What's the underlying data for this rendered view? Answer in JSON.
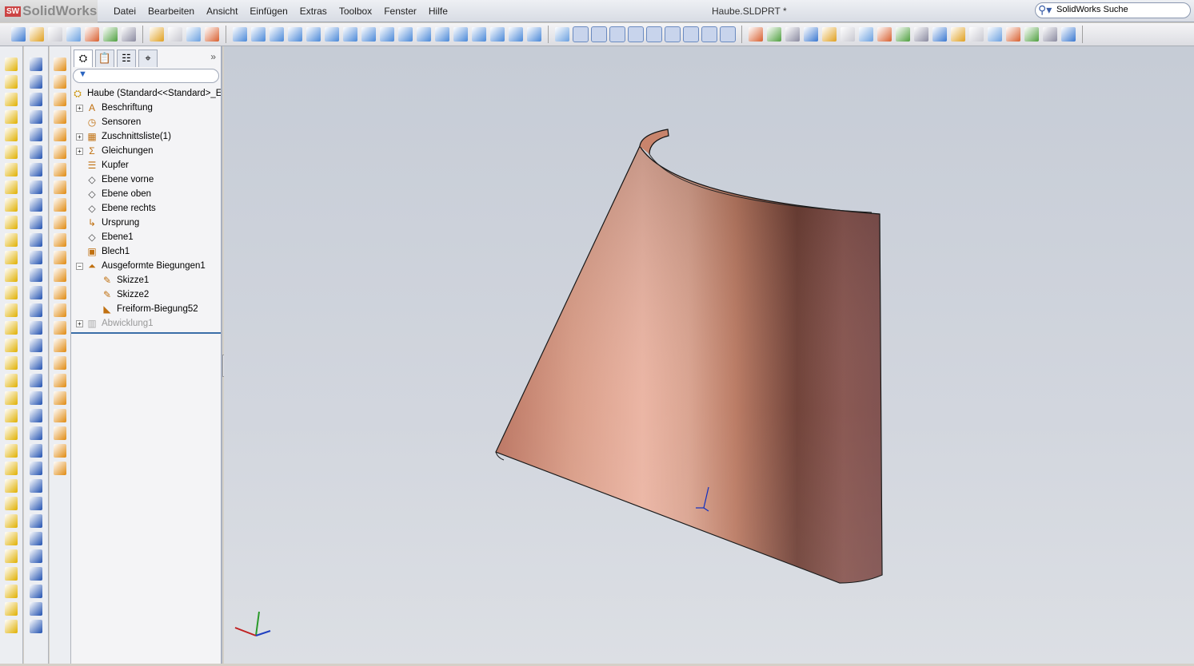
{
  "app": {
    "logo": "SolidWorks",
    "doc_title": "Haube.SLDPRT *"
  },
  "menu": [
    "Datei",
    "Bearbeiten",
    "Ansicht",
    "Einfügen",
    "Extras",
    "Toolbox",
    "Fenster",
    "Hilfe"
  ],
  "search": {
    "placeholder": "SolidWorks Suche"
  },
  "toolbar": {
    "groups": [
      [
        "new-document",
        "open",
        "rebuild",
        "print",
        "print-preview",
        "options",
        "file-properties"
      ],
      [
        "undo",
        "redo",
        "traffic-light",
        "select"
      ],
      [
        "view-front",
        "view-back",
        "view-left",
        "view-right",
        "view-top",
        "view-bottom",
        "view-iso",
        "view-trimetric",
        "view-dimetric",
        "shaded",
        "shaded-edges",
        "hidden-lines",
        "wireframe",
        "section-view",
        "zoom-fit",
        "rotate",
        "pan"
      ],
      [
        "sketch",
        "snap-1",
        "snap-2",
        "snap-3",
        "snap-4",
        "snap-5",
        "snap-6",
        "snap-7",
        "snap-8",
        "snap-9"
      ],
      [
        "sheet-metal-base",
        "miter",
        "lofted-bend",
        "edge-flange",
        "corner",
        "hem",
        "jog",
        "sketched-bend",
        "cross-break",
        "closed-corner",
        "welded-corner",
        "break-corner",
        "unfold",
        "fold",
        "flatten",
        "no-bends",
        "rip",
        "insert-bends"
      ]
    ]
  },
  "tree": {
    "tabs": [
      "featuremanager-tab",
      "propertymanager-tab",
      "configurationmanager-tab",
      "dimxpert-tab"
    ],
    "root": "Haube  (Standard<<Standard>_E",
    "nodes": [
      {
        "label": "Beschriftung",
        "icon": "annotations-icon",
        "expand": "+",
        "indent": 0
      },
      {
        "label": "Sensoren",
        "icon": "sensors-icon",
        "expand": "",
        "indent": 0
      },
      {
        "label": "Zuschnittsliste(1)",
        "icon": "cutlist-icon",
        "expand": "+",
        "indent": 0
      },
      {
        "label": "Gleichungen",
        "icon": "equations-icon",
        "expand": "+",
        "indent": 0
      },
      {
        "label": "Kupfer",
        "icon": "material-icon",
        "expand": "",
        "indent": 0
      },
      {
        "label": "Ebene vorne",
        "icon": "plane-icon",
        "expand": "",
        "indent": 0
      },
      {
        "label": "Ebene oben",
        "icon": "plane-icon",
        "expand": "",
        "indent": 0
      },
      {
        "label": "Ebene rechts",
        "icon": "plane-icon",
        "expand": "",
        "indent": 0
      },
      {
        "label": "Ursprung",
        "icon": "origin-icon",
        "expand": "",
        "indent": 0
      },
      {
        "label": "Ebene1",
        "icon": "plane-icon",
        "expand": "",
        "indent": 0
      },
      {
        "label": "Blech1",
        "icon": "sheet-metal-icon",
        "expand": "",
        "indent": 0
      },
      {
        "label": "Ausgeformte Biegungen1",
        "icon": "lofted-bend-icon",
        "expand": "−",
        "indent": 0
      },
      {
        "label": "Skizze1",
        "icon": "sketch-icon",
        "expand": "",
        "indent": 1
      },
      {
        "label": "Skizze2",
        "icon": "sketch-icon",
        "expand": "",
        "indent": 1
      },
      {
        "label": "Freiform-Biegung52",
        "icon": "freeform-bend-icon",
        "expand": "",
        "indent": 1
      },
      {
        "label": "Abwicklung1",
        "icon": "flat-pattern-icon",
        "expand": "+",
        "indent": 0,
        "disabled": true
      }
    ]
  },
  "colors": {
    "copper_light": "#e8a690",
    "copper_dark": "#5a2e28",
    "accent": "#3a6ea8"
  }
}
